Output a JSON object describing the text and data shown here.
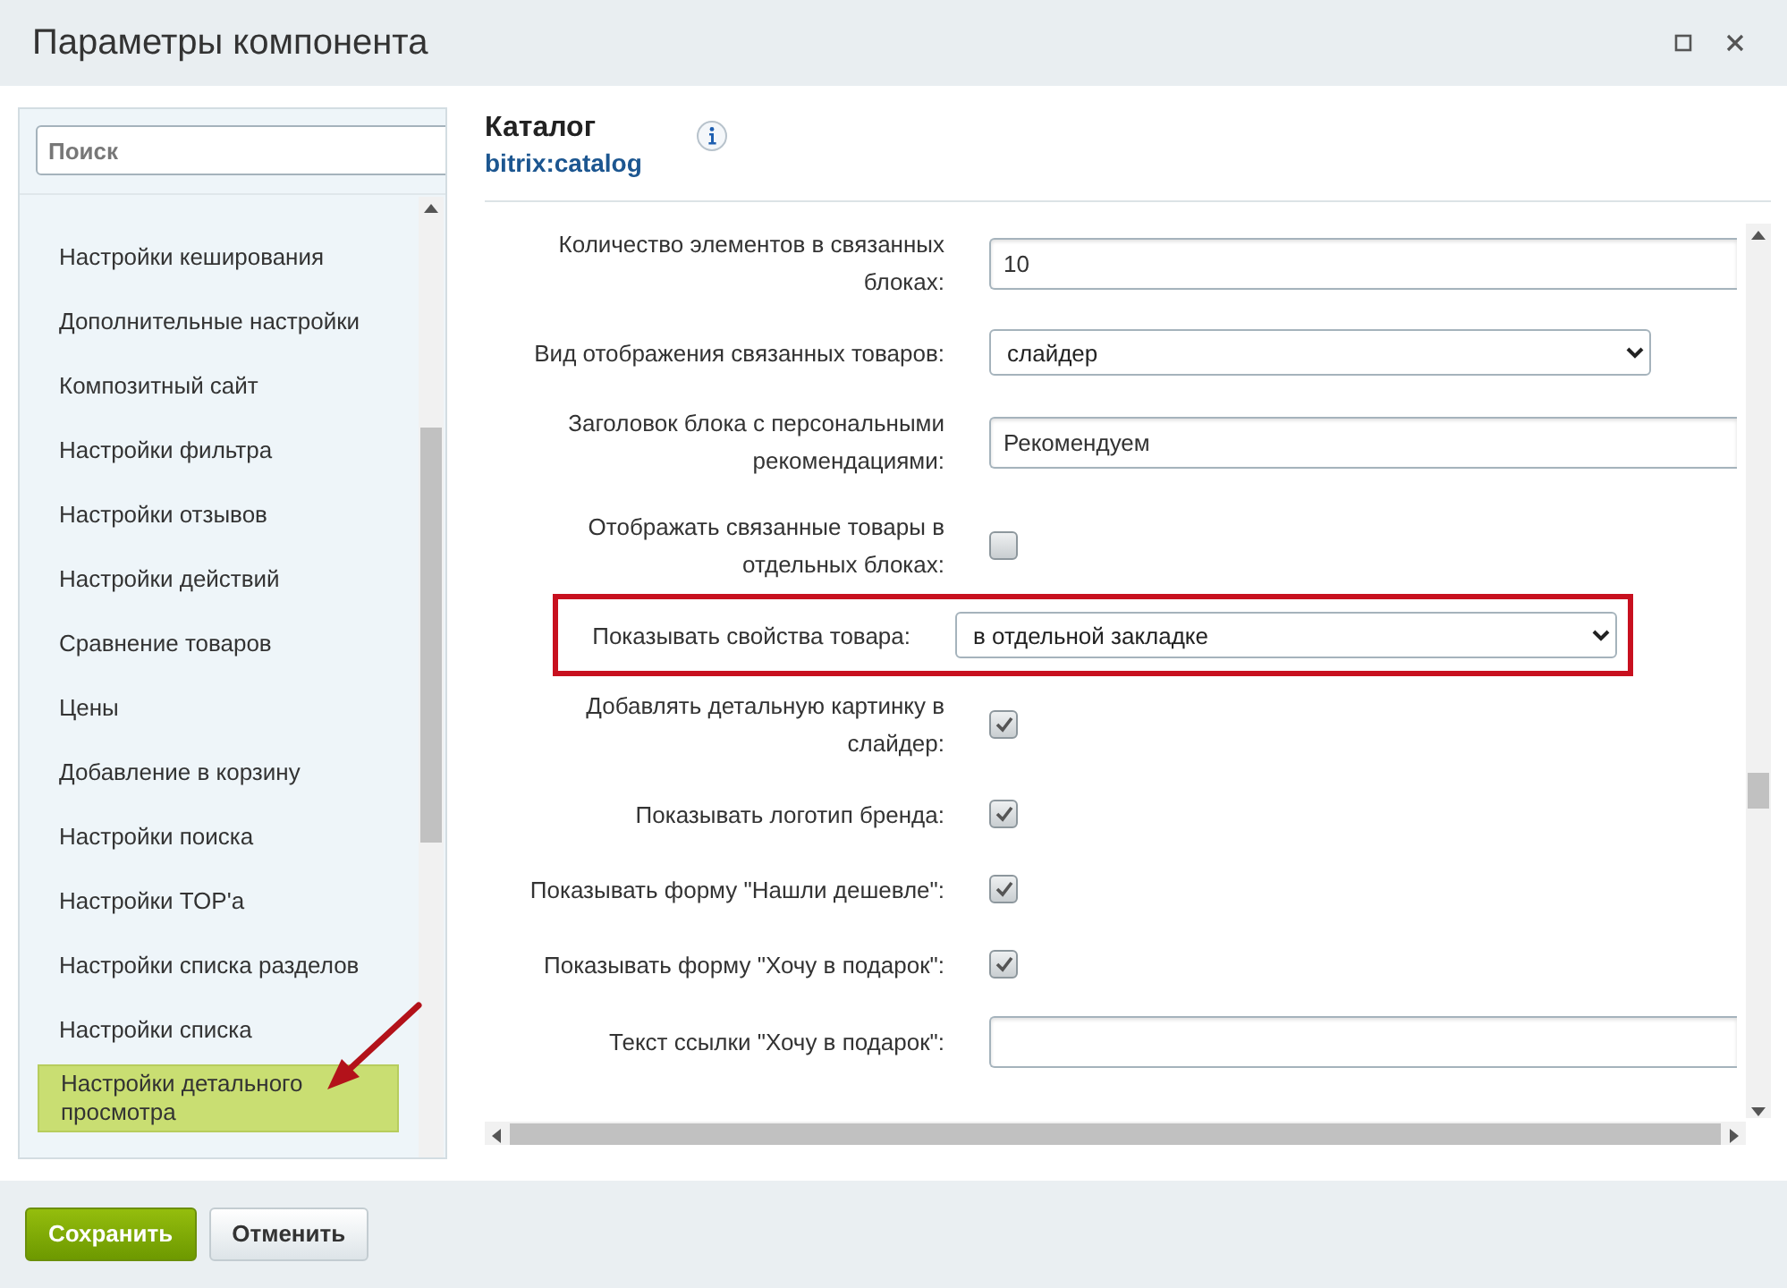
{
  "window": {
    "title": "Параметры компонента"
  },
  "sidebar": {
    "search": {
      "placeholder": "Поиск"
    },
    "items": [
      {
        "label": "Настройки кеширования",
        "selected": false
      },
      {
        "label": "Дополнительные настройки",
        "selected": false
      },
      {
        "label": "Композитный сайт",
        "selected": false
      },
      {
        "label": "Настройки фильтра",
        "selected": false
      },
      {
        "label": "Настройки отзывов",
        "selected": false
      },
      {
        "label": "Настройки действий",
        "selected": false
      },
      {
        "label": "Сравнение товаров",
        "selected": false
      },
      {
        "label": "Цены",
        "selected": false
      },
      {
        "label": "Добавление в корзину",
        "selected": false
      },
      {
        "label": "Настройки поиска",
        "selected": false
      },
      {
        "label": "Настройки TOP'a",
        "selected": false
      },
      {
        "label": "Настройки списка разделов",
        "selected": false
      },
      {
        "label": "Настройки списка",
        "selected": false
      },
      {
        "label": "Настройки детального просмотра",
        "selected": true
      }
    ]
  },
  "component": {
    "title": "Каталог",
    "code": "bitrix:catalog"
  },
  "settings": [
    {
      "kind": "input",
      "label": "Количество элементов в связанных блоках:",
      "value": "10",
      "highlighted": false
    },
    {
      "kind": "select",
      "label": "Вид отображения связанных товаров:",
      "value": "слайдер",
      "highlighted": false
    },
    {
      "kind": "input",
      "label": "Заголовок блока с персональными рекомендациями:",
      "value": "Рекомендуем",
      "highlighted": false
    },
    {
      "kind": "checkbox",
      "label": "Отображать связанные товары в отдельных блоках:",
      "checked": false,
      "highlighted": false
    },
    {
      "kind": "select",
      "label": "Показывать свойства товара:",
      "value": "в отдельной закладке",
      "highlighted": true
    },
    {
      "kind": "checkbox",
      "label": "Добавлять детальную картинку в слайдер:",
      "checked": true,
      "highlighted": false
    },
    {
      "kind": "checkbox",
      "label": "Показывать логотип бренда:",
      "checked": true,
      "highlighted": false
    },
    {
      "kind": "checkbox",
      "label": "Показывать форму \"Нашли дешевле\":",
      "checked": true,
      "highlighted": false
    },
    {
      "kind": "checkbox",
      "label": "Показывать форму \"Хочу в подарок\":",
      "checked": true,
      "highlighted": false
    },
    {
      "kind": "input",
      "label": "Текст ссылки \"Хочу в подарок\":",
      "highlighted": false
    }
  ],
  "buttons": [
    {
      "label": "Сохранить",
      "kind": "primary"
    },
    {
      "label": "Отменить",
      "kind": "secondary"
    }
  ]
}
